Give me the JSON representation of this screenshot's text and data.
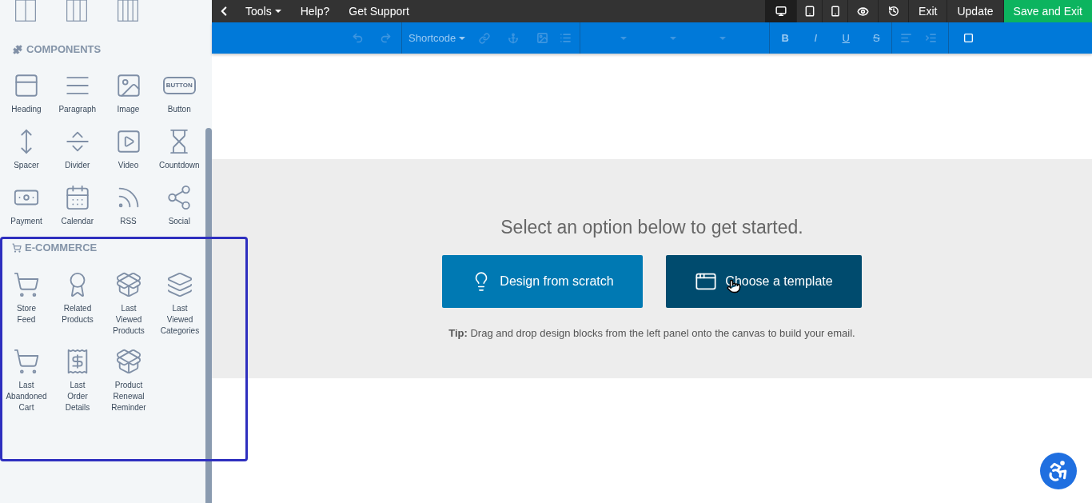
{
  "sidebar": {
    "components_title": "COMPONENTS",
    "components": [
      {
        "label": "Heading"
      },
      {
        "label": "Paragraph"
      },
      {
        "label": "Image"
      },
      {
        "label": "Button",
        "icon_text": "BUTTON"
      },
      {
        "label": "Spacer"
      },
      {
        "label": "Divider"
      },
      {
        "label": "Video"
      },
      {
        "label": "Countdown"
      },
      {
        "label": "Payment"
      },
      {
        "label": "Calendar"
      },
      {
        "label": "RSS"
      },
      {
        "label": "Social"
      }
    ],
    "ecommerce_title": "E-COMMERCE",
    "ecommerce": [
      {
        "label": "Store\nFeed"
      },
      {
        "label": "Related\nProducts"
      },
      {
        "label": "Last\nViewed\nProducts"
      },
      {
        "label": "Last\nViewed\nCategories"
      },
      {
        "label": "Last\nAbandoned\nCart"
      },
      {
        "label": "Last\nOrder\nDetails"
      },
      {
        "label": "Product\nRenewal\nReminder"
      }
    ]
  },
  "topbar": {
    "menu": [
      {
        "label": "Tools",
        "dropdown": true
      },
      {
        "label": "Help?",
        "dropdown": false
      },
      {
        "label": "Get Support",
        "dropdown": false
      }
    ],
    "devices": [
      {
        "kind": "desktop",
        "selected": true
      },
      {
        "kind": "tablet",
        "selected": false
      },
      {
        "kind": "mobile",
        "selected": false
      }
    ],
    "actions": [
      {
        "label": "Exit",
        "kind": "plain"
      },
      {
        "label": "Update",
        "kind": "plain"
      },
      {
        "label": "Save and Exit",
        "kind": "primary"
      }
    ]
  },
  "toolbar": {
    "shortcode": {
      "label": "Shortcode",
      "disabled": true
    },
    "format": [
      {
        "label": "B",
        "kind": "bold",
        "disabled": true
      },
      {
        "label": "I",
        "kind": "italic",
        "disabled": true
      },
      {
        "label": "U",
        "kind": "underline",
        "disabled": true
      },
      {
        "label": "S",
        "kind": "strike",
        "disabled": true
      }
    ]
  },
  "canvas": {
    "heading": "Select an option below to get started.",
    "options": [
      {
        "label": "Design from scratch",
        "kind": "scratch"
      },
      {
        "label": "Choose a template",
        "kind": "template"
      }
    ],
    "tip": "**Tip:** Drag and drop design blocks from the left panel onto the canvas to build your email."
  }
}
